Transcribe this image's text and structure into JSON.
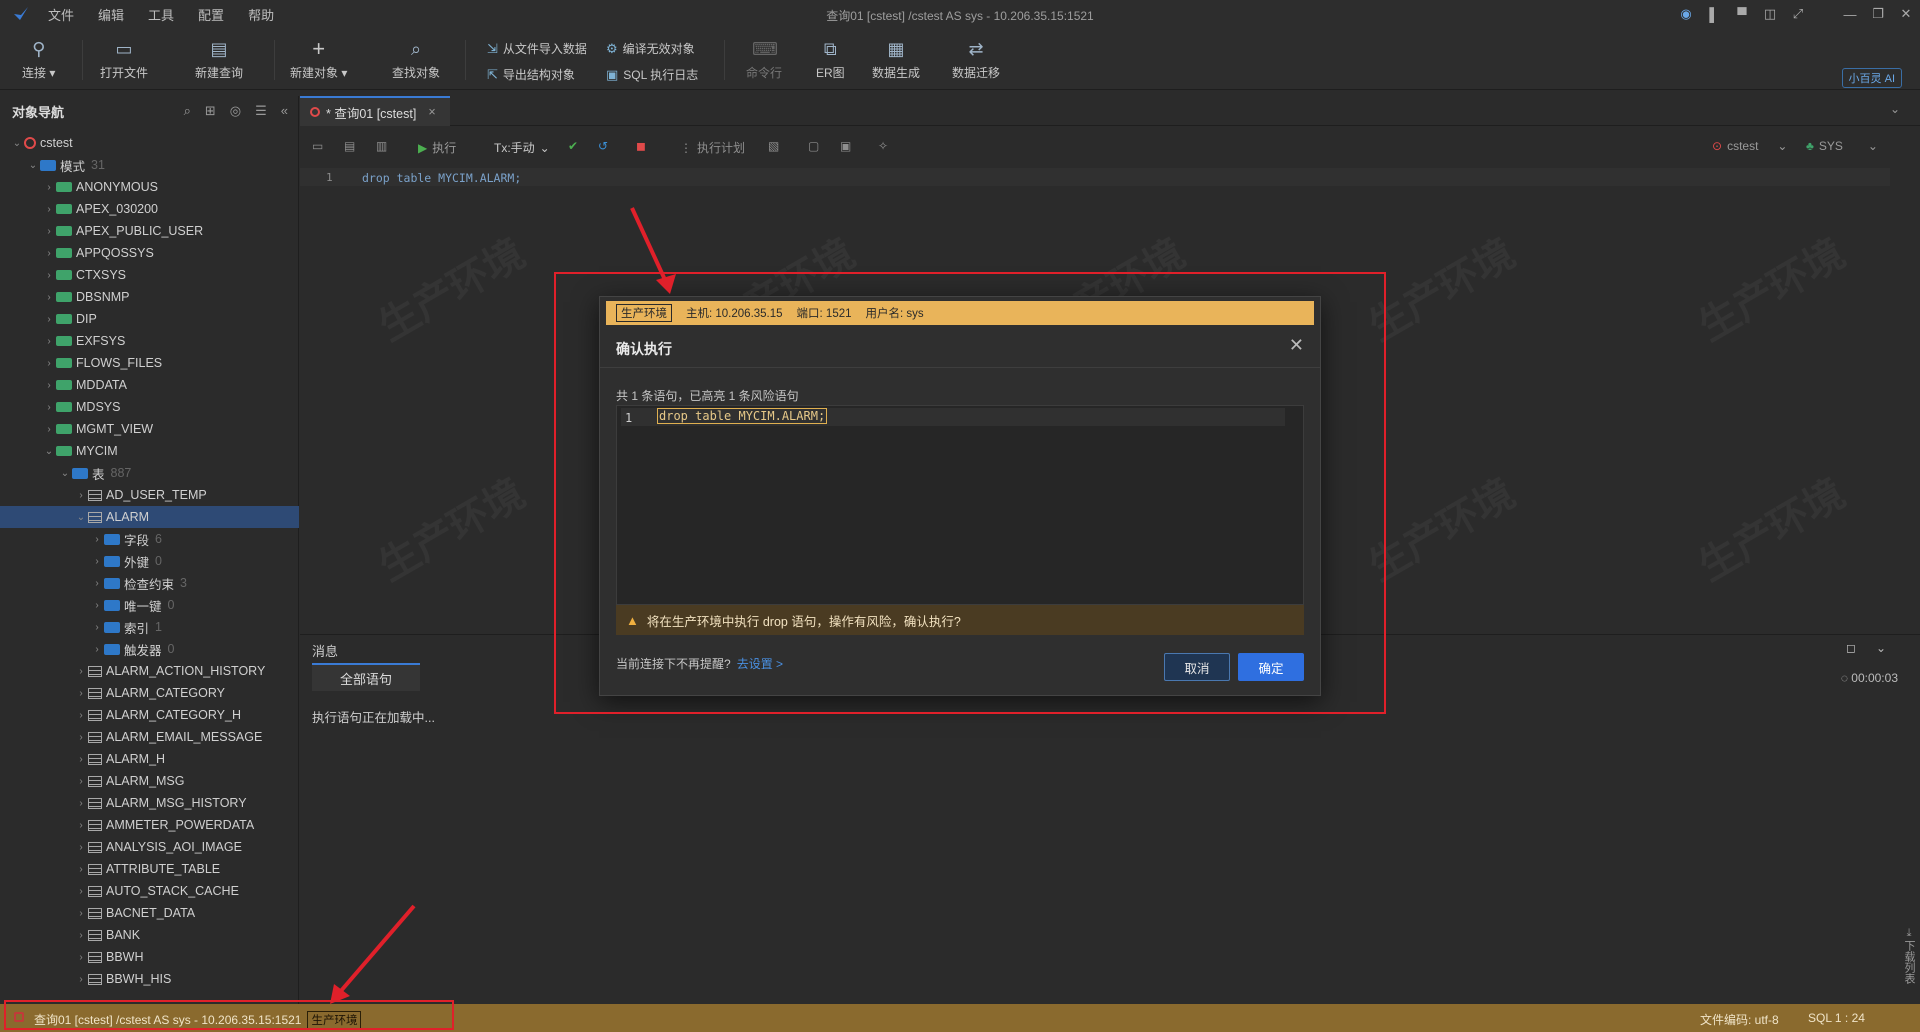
{
  "app": {
    "title": "查询01 [cstest] /cstest AS sys  - 10.206.35.15:1521",
    "menu": [
      "文件",
      "编辑",
      "工具",
      "配置",
      "帮助"
    ]
  },
  "toolbar": {
    "connect": "连接",
    "open_file": "打开文件",
    "new_query": "新建查询",
    "new_object": "新建对象",
    "find_object": "查找对象",
    "import_from_file": "从文件导入数据",
    "compile_invalid": "编译无效对象",
    "export_structure": "导出结构对象",
    "sql_log": "SQL 执行日志",
    "command_line": "命令行",
    "er_diagram": "ER图",
    "data_generate": "数据生成",
    "data_migrate": "数据迁移",
    "ai_assistant": "小百灵 AI"
  },
  "nav": {
    "title": "对象导航",
    "items": [
      {
        "label": "cstest",
        "icon": "database-icon",
        "level": 0,
        "expanded": true,
        "count": ""
      },
      {
        "label": "模式",
        "icon": "folder-icon",
        "level": 1,
        "expanded": true,
        "count": "31"
      },
      {
        "label": "ANONYMOUS",
        "icon": "schema-icon",
        "level": 2,
        "count": ""
      },
      {
        "label": "APEX_030200",
        "icon": "schema-icon",
        "level": 2,
        "count": ""
      },
      {
        "label": "APEX_PUBLIC_USER",
        "icon": "schema-icon",
        "level": 2,
        "count": ""
      },
      {
        "label": "APPQOSSYS",
        "icon": "schema-icon",
        "level": 2,
        "count": ""
      },
      {
        "label": "CTXSYS",
        "icon": "schema-icon",
        "level": 2,
        "count": ""
      },
      {
        "label": "DBSNMP",
        "icon": "schema-icon",
        "level": 2,
        "count": ""
      },
      {
        "label": "DIP",
        "icon": "schema-icon",
        "level": 2,
        "count": ""
      },
      {
        "label": "EXFSYS",
        "icon": "schema-icon",
        "level": 2,
        "count": ""
      },
      {
        "label": "FLOWS_FILES",
        "icon": "schema-icon",
        "level": 2,
        "count": ""
      },
      {
        "label": "MDDATA",
        "icon": "schema-icon",
        "level": 2,
        "count": ""
      },
      {
        "label": "MDSYS",
        "icon": "schema-icon",
        "level": 2,
        "count": ""
      },
      {
        "label": "MGMT_VIEW",
        "icon": "schema-icon",
        "level": 2,
        "count": ""
      },
      {
        "label": "MYCIM",
        "icon": "schema-icon",
        "level": 2,
        "expanded": true,
        "count": ""
      },
      {
        "label": "表",
        "icon": "folder-icon",
        "level": 3,
        "expanded": true,
        "count": "887"
      },
      {
        "label": "AD_USER_TEMP",
        "icon": "table-icon",
        "level": 4,
        "count": ""
      },
      {
        "label": "ALARM",
        "icon": "table-icon",
        "level": 4,
        "expanded": true,
        "selected": true,
        "count": ""
      },
      {
        "label": "字段",
        "icon": "folder-icon",
        "level": 5,
        "count": "6"
      },
      {
        "label": "外键",
        "icon": "folder-icon",
        "level": 5,
        "count": "0"
      },
      {
        "label": "检查约束",
        "icon": "folder-icon",
        "level": 5,
        "count": "3"
      },
      {
        "label": "唯一键",
        "icon": "folder-icon",
        "level": 5,
        "count": "0"
      },
      {
        "label": "索引",
        "icon": "folder-icon",
        "level": 5,
        "count": "1"
      },
      {
        "label": "触发器",
        "icon": "folder-icon",
        "level": 5,
        "count": "0"
      },
      {
        "label": "ALARM_ACTION_HISTORY",
        "icon": "table-icon",
        "level": 4,
        "count": ""
      },
      {
        "label": "ALARM_CATEGORY",
        "icon": "table-icon",
        "level": 4,
        "count": ""
      },
      {
        "label": "ALARM_CATEGORY_H",
        "icon": "table-icon",
        "level": 4,
        "count": ""
      },
      {
        "label": "ALARM_EMAIL_MESSAGE",
        "icon": "table-icon",
        "level": 4,
        "count": ""
      },
      {
        "label": "ALARM_H",
        "icon": "table-icon",
        "level": 4,
        "count": ""
      },
      {
        "label": "ALARM_MSG",
        "icon": "table-icon",
        "level": 4,
        "count": ""
      },
      {
        "label": "ALARM_MSG_HISTORY",
        "icon": "table-icon",
        "level": 4,
        "count": ""
      },
      {
        "label": "AMMETER_POWERDATA",
        "icon": "table-icon",
        "level": 4,
        "count": ""
      },
      {
        "label": "ANALYSIS_AOI_IMAGE",
        "icon": "table-icon",
        "level": 4,
        "count": ""
      },
      {
        "label": "ATTRIBUTE_TABLE",
        "icon": "table-icon",
        "level": 4,
        "count": ""
      },
      {
        "label": "AUTO_STACK_CACHE",
        "icon": "table-icon",
        "level": 4,
        "count": ""
      },
      {
        "label": "BACNET_DATA",
        "icon": "table-icon",
        "level": 4,
        "count": ""
      },
      {
        "label": "BANK",
        "icon": "table-icon",
        "level": 4,
        "count": ""
      },
      {
        "label": "BBWH",
        "icon": "table-icon",
        "level": 4,
        "count": ""
      },
      {
        "label": "BBWH_HIS",
        "icon": "table-icon",
        "level": 4,
        "count": ""
      }
    ]
  },
  "editor": {
    "tab_label": "* 查询01 [cstest]",
    "run": "执行",
    "tx_mode": "Tx:手动",
    "explain": "执行计划",
    "conn_name": "cstest",
    "schema_name": "SYS",
    "line_number": "1",
    "code": "drop table MYCIM.ALARM;",
    "watermark": "生产环境"
  },
  "messages": {
    "title": "消息",
    "tab_all": "全部语句",
    "body": "执行语句正在加载中...",
    "elapsed": "00:00:03"
  },
  "download_list_label": "下载列表",
  "dialog": {
    "env_tag": "生产环境",
    "host": "主机: 10.206.35.15",
    "port": "端口: 1521",
    "user": "用户名: sys",
    "title": "确认执行",
    "summary": "共 1 条语句，已高亮 1 条风险语句",
    "line_number": "1",
    "code": "drop table MYCIM.ALARM;",
    "warning": "将在生产环境中执行 drop 语句，操作有风险，确认执行?",
    "no_remind": "当前连接下不再提醒?",
    "settings_link": "去设置 >",
    "cancel": "取消",
    "confirm": "确定"
  },
  "statusbar": {
    "text": "查询01 [cstest] /cstest AS sys  - 10.206.35.15:1521",
    "env_tag": "生产环境",
    "encoding": "文件编码:  utf-8",
    "position": "SQL 1 : 24"
  },
  "colors": {
    "accent": "#3a7bd5",
    "warning_bar": "#e9b45a",
    "status_bar": "#8a6a2e",
    "annotation": "#e0202a"
  }
}
